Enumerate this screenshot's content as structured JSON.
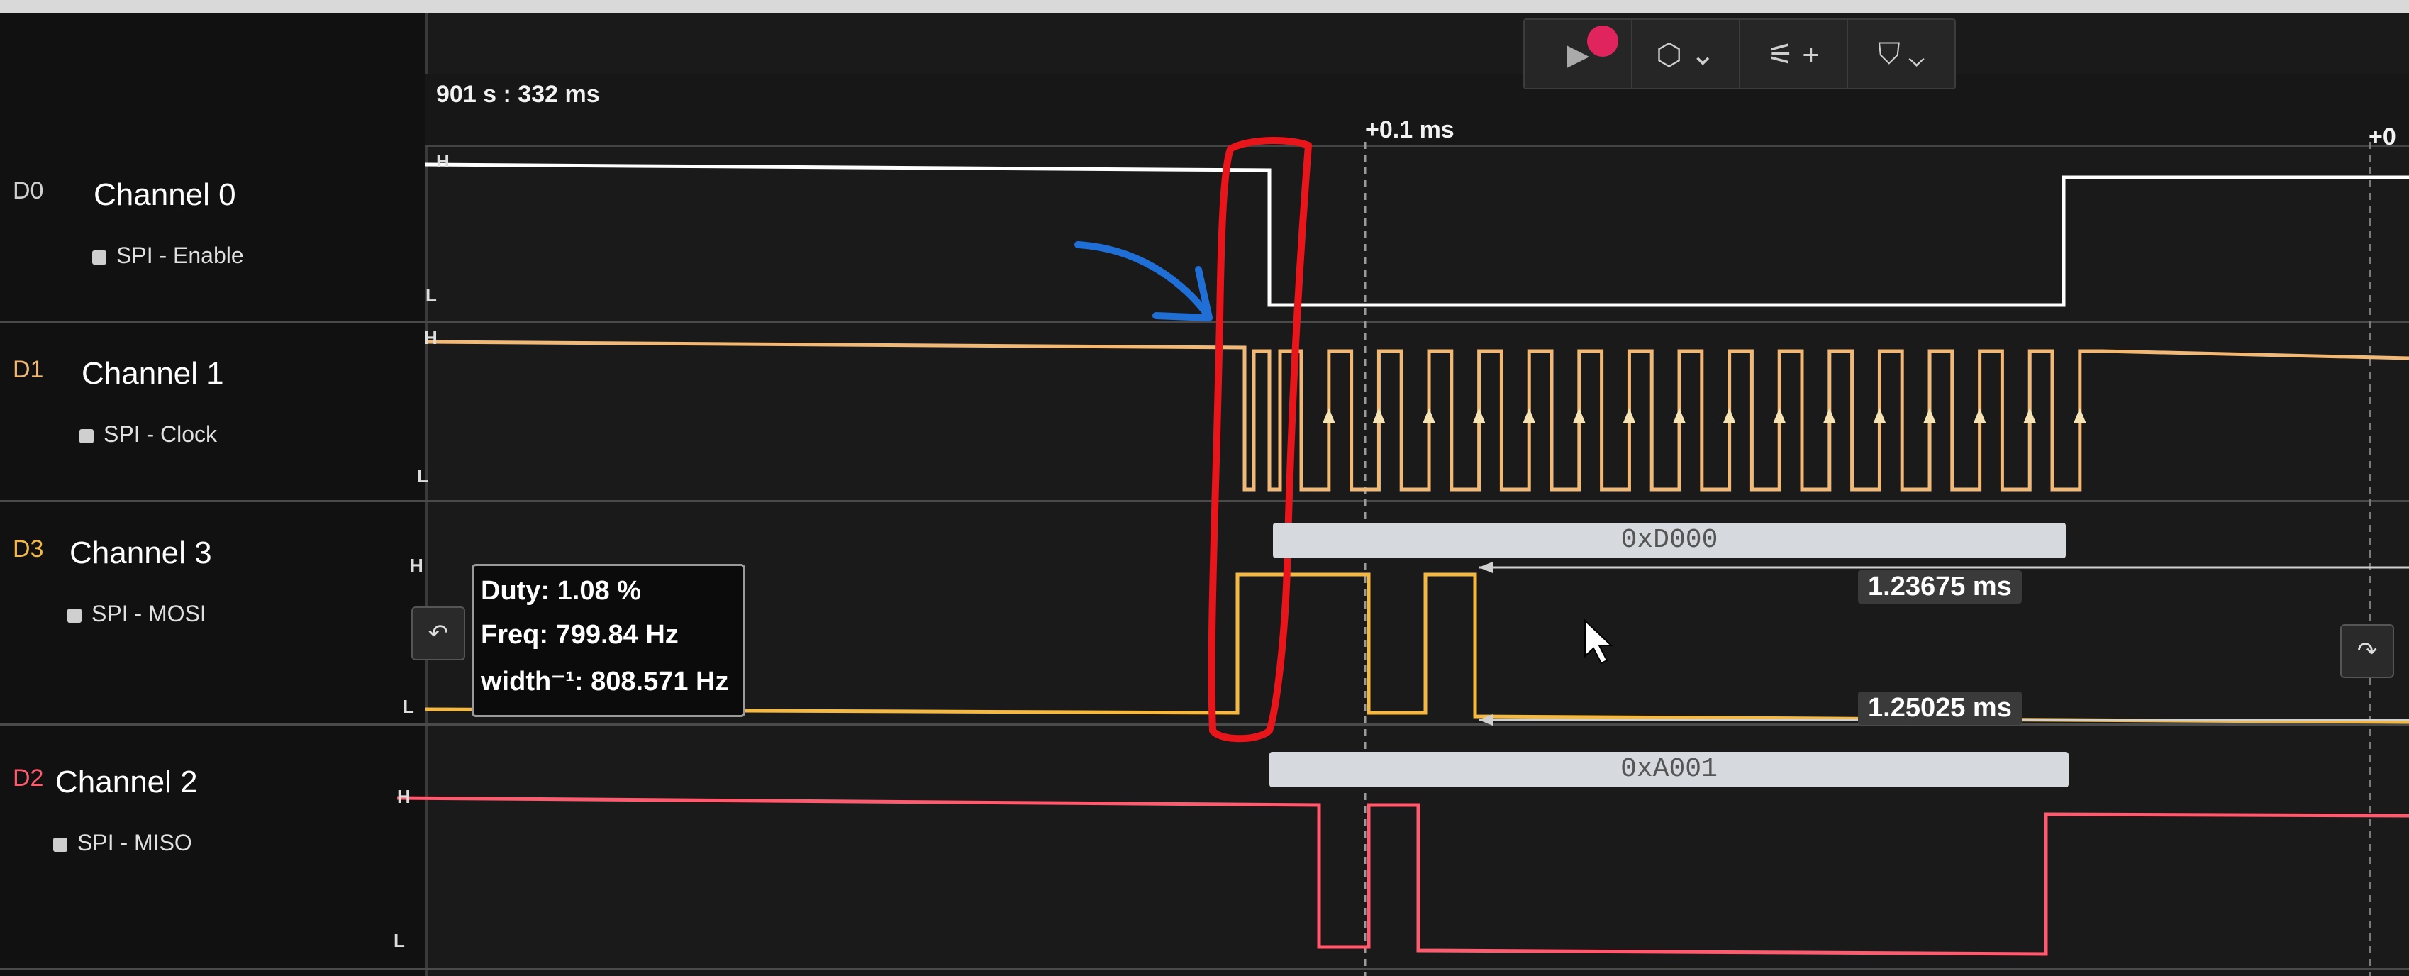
{
  "timeline": {
    "absolute_time": "901 s : 332 ms",
    "offset_marker": "+0.1 ms",
    "offset_marker_right": "+0"
  },
  "toolbar": [
    {
      "name": "record-button",
      "icon": "play-icon",
      "glyph": "▶"
    },
    {
      "name": "trigger-button",
      "icon": "trigger-icon",
      "glyph": "⬡ ⌄"
    },
    {
      "name": "analyzer-add-button",
      "icon": "analyzer-icon",
      "glyph": "⚟ +"
    },
    {
      "name": "measure-button",
      "icon": "marker-icon",
      "glyph": "⛉ ⌄"
    }
  ],
  "channels": [
    {
      "id": "D0",
      "name": "Channel 0",
      "analyzer": "SPI - Enable",
      "color": "#ffffff"
    },
    {
      "id": "D1",
      "name": "Channel 1",
      "analyzer": "SPI - Clock",
      "color": "#f2b875"
    },
    {
      "id": "D3",
      "name": "Channel 3",
      "analyzer": "SPI - MOSI",
      "color": "#f5b942"
    },
    {
      "id": "D2",
      "name": "Channel 2",
      "analyzer": "SPI - MISO",
      "color": "#ff5a6e"
    }
  ],
  "level_labels": {
    "high": "H",
    "low": "L"
  },
  "decoded": {
    "mosi_value": "0xD000",
    "miso_value": "0xA001"
  },
  "measurements": {
    "width_a": "1.23675 ms",
    "width_b": "1.25025 ms"
  },
  "tooltip": {
    "duty": "Duty: 1.08 %",
    "freq": "Freq: 799.84 Hz",
    "width": "width⁻¹: 808.571 Hz"
  },
  "annotation_colors": {
    "red_marker": "#e8161b",
    "blue_arrow": "#1f6fd6"
  }
}
